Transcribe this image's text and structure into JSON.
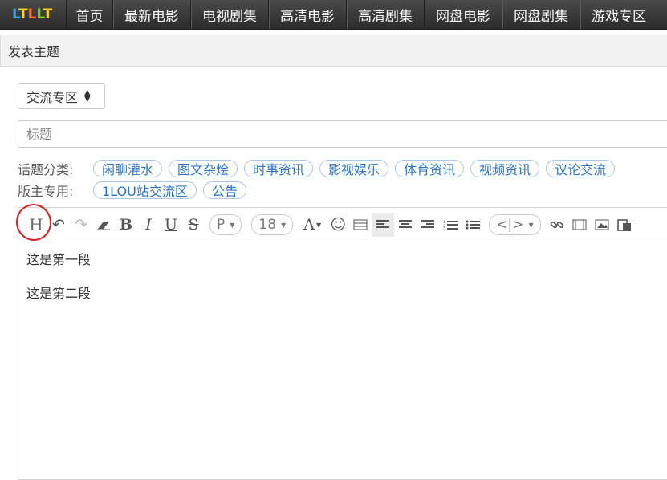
{
  "nav": {
    "logo_text": "LTLLT",
    "items": [
      "首页",
      "最新电影",
      "电视剧集",
      "高清电影",
      "高清剧集",
      "网盘电影",
      "网盘剧集",
      "游戏专区"
    ]
  },
  "header": {
    "title": "发表主题"
  },
  "form": {
    "forum_select": "交流专区",
    "title_placeholder": "标题",
    "topic_label": "话题分类:",
    "topics": [
      "闲聊灌水",
      "图文杂烩",
      "时事资讯",
      "影视娱乐",
      "体育资讯",
      "视频资讯",
      "议论交流"
    ],
    "mod_label": "版主专用:",
    "mod_topics": [
      "1LOU站交流区",
      "公告"
    ]
  },
  "toolbar": {
    "paragraph_format": "P",
    "font_size": "18",
    "code_label": "<|>"
  },
  "editor": {
    "paragraphs": [
      "这是第一段",
      "这是第二段"
    ]
  },
  "colors": {
    "nav_bg": "#333333",
    "tag_text": "#2b74c4",
    "annotation_ring": "#e02020"
  }
}
